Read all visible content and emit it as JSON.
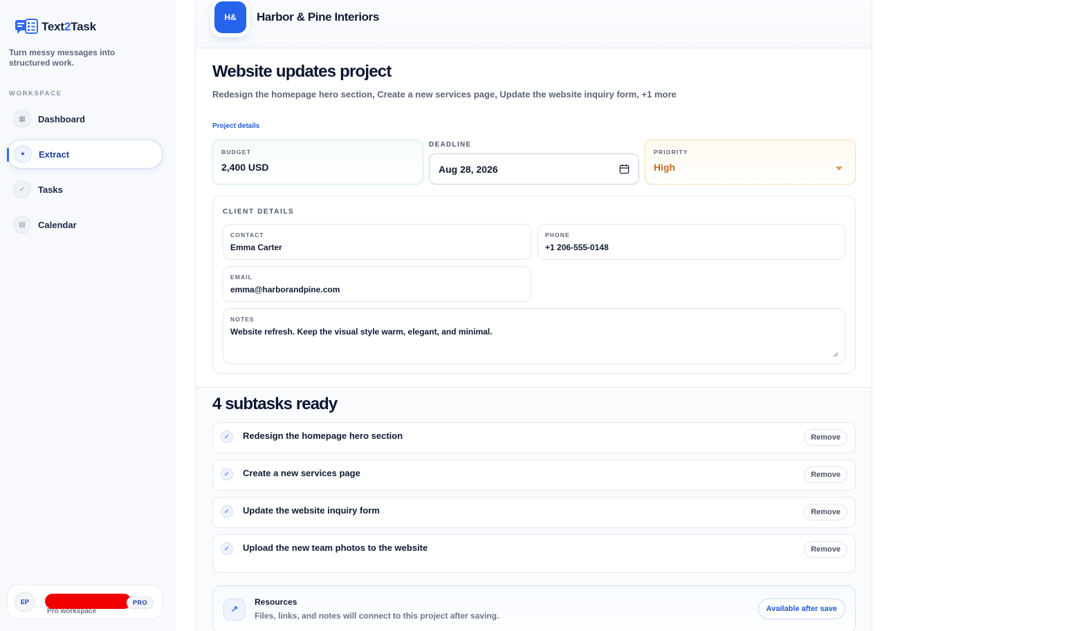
{
  "sidebar": {
    "brand_prefix": "Text",
    "brand_two": "2",
    "brand_suffix": "Task",
    "tagline": "Turn messy messages into structured work.",
    "section_label": "WORKSPACE",
    "items": [
      {
        "label": "Dashboard",
        "icon": "grid-icon",
        "glyph": "▦",
        "active": false
      },
      {
        "label": "Extract",
        "icon": "sparkle-icon",
        "glyph": "✦",
        "active": true
      },
      {
        "label": "Tasks",
        "icon": "check-icon",
        "glyph": "✓",
        "active": false
      },
      {
        "label": "Calendar",
        "icon": "calendar-icon",
        "glyph": "▤",
        "active": false
      }
    ],
    "user": {
      "initials": "EP",
      "subtitle": "Pro workspace",
      "badge": "PRO"
    }
  },
  "header": {
    "logo_text": "H&",
    "company_name": "Harbor & Pine Interiors"
  },
  "project": {
    "title": "Website updates project",
    "summary": "Redesign the homepage hero section, Create a new services page, Update the website inquiry form, +1 more",
    "details_link": "Project details",
    "budget_label": "BUDGET",
    "budget_value": "2,400 USD",
    "deadline_label": "DEADLINE",
    "deadline_value": "Aug 28, 2026",
    "priority_label": "PRIORITY",
    "priority_value": "High"
  },
  "client": {
    "title": "CLIENT DETAILS",
    "contact_label": "CONTACT",
    "contact_value": "Emma Carter",
    "phone_label": "PHONE",
    "phone_value": "+1 206-555-0148",
    "email_label": "EMAIL",
    "email_value": "emma@harborandpine.com",
    "notes_label": "NOTES",
    "notes_value": "Website refresh. Keep the visual style warm, elegant, and minimal."
  },
  "subtasks": {
    "title": "4 subtasks ready",
    "remove_label": "Remove",
    "items": [
      "Redesign the homepage hero section",
      "Create a new services page",
      "Update the website inquiry form",
      "Upload the new team photos to the website"
    ]
  },
  "resources": {
    "icon_glyph": "↗",
    "title": "Resources",
    "subtitle": "Files, links, and notes will connect to this project after saving.",
    "button": "Available after save"
  },
  "colors": {
    "accent": "#2f6bf0",
    "priority_high": "#c46a22",
    "redaction": "#f00000"
  }
}
